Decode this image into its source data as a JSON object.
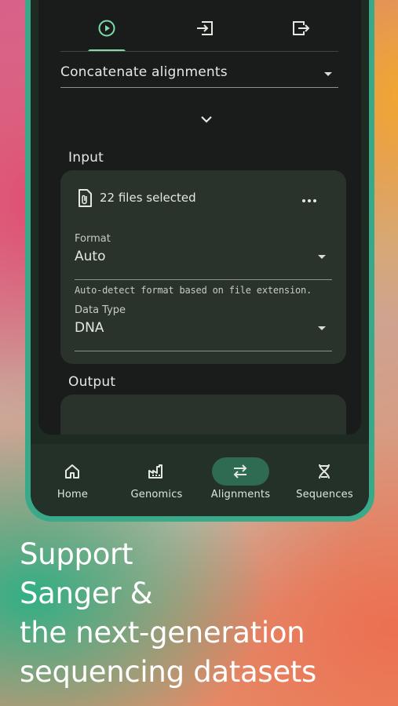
{
  "top_tabs": {
    "items": [
      {
        "name": "run",
        "icon": "play-circle-icon",
        "active": true
      },
      {
        "name": "import",
        "icon": "import-icon",
        "active": false
      },
      {
        "name": "export",
        "icon": "export-icon",
        "active": false
      }
    ]
  },
  "method_select": {
    "value": "Concatenate alignments",
    "icon": "dropdown-caret-icon"
  },
  "expand": {
    "icon": "chevron-down-icon"
  },
  "input": {
    "title": "Input",
    "files_text": "22 files selected",
    "files_icon": "paperclip-document-icon",
    "more_icon": "more-horizontal-icon",
    "format": {
      "label": "Format",
      "value": "Auto",
      "helper": "Auto-detect format based on file extension."
    },
    "data_type": {
      "label": "Data Type",
      "value": "DNA"
    }
  },
  "output": {
    "title": "Output"
  },
  "bottom_nav": {
    "items": [
      {
        "label": "Home",
        "icon": "home-icon",
        "active": false
      },
      {
        "label": "Genomics",
        "icon": "factory-icon",
        "active": false
      },
      {
        "label": "Alignments",
        "icon": "swap-arrows-icon",
        "active": true
      },
      {
        "label": "Sequences",
        "icon": "dna-icon",
        "active": false
      }
    ]
  },
  "tagline": {
    "line1": "Support",
    "line2": "Sanger &",
    "line3": "the next-generation",
    "line4": "sequencing datasets"
  },
  "colors": {
    "accent": "#7fdcaa",
    "active_pill": "#2f6a53",
    "phone_frame": "#3aa98a",
    "card_bg": "#29332c",
    "screen_bg": "#191c1a"
  }
}
